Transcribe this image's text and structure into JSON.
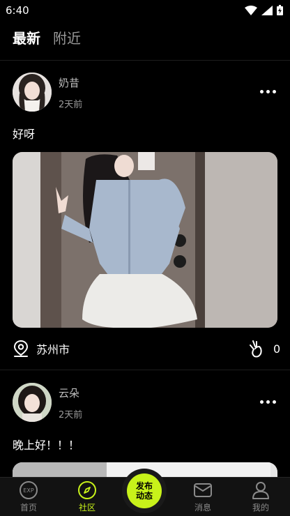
{
  "status_bar": {
    "time": "6:40"
  },
  "tabs": [
    {
      "label": "最新",
      "active": true
    },
    {
      "label": "附近",
      "active": false
    }
  ],
  "posts": [
    {
      "username": "奶昔",
      "time_ago": "2天前",
      "text": "好呀",
      "location": "苏州市",
      "likes": "0"
    },
    {
      "username": "云朵",
      "time_ago": "2天前",
      "text": "晚上好！！！"
    }
  ],
  "publish": {
    "line1": "发布",
    "line2": "动态"
  },
  "nav": [
    {
      "label": "首页",
      "icon": "home-icon",
      "active": false
    },
    {
      "label": "社区",
      "icon": "compass-icon",
      "active": true
    },
    {
      "label": "消息",
      "icon": "mail-icon",
      "active": false
    },
    {
      "label": "我的",
      "icon": "user-icon",
      "active": false
    }
  ],
  "colors": {
    "accent": "#c8f21a",
    "background": "#000000",
    "nav_inactive": "#8a8a8a"
  }
}
